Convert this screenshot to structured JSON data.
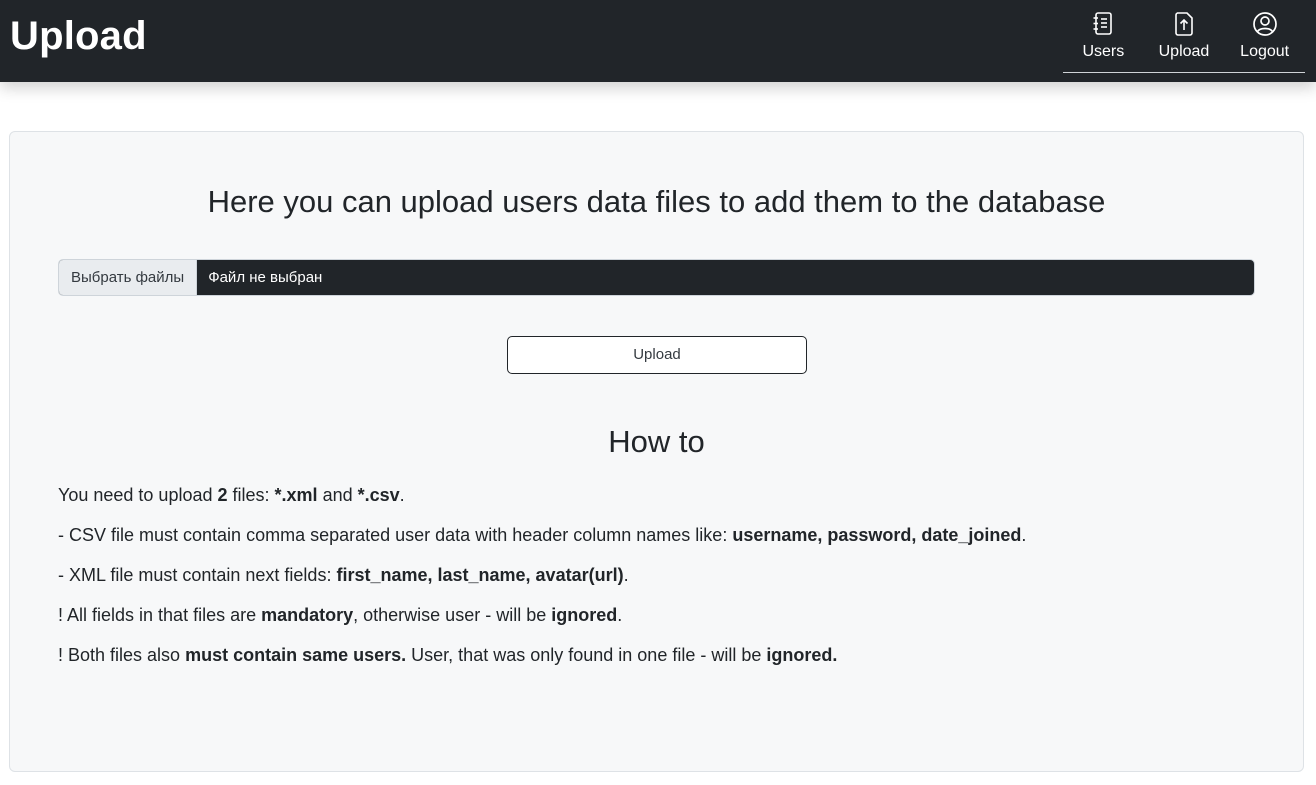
{
  "navbar": {
    "brand": "Upload",
    "items": [
      {
        "label": "Users",
        "icon": "journal-icon"
      },
      {
        "label": "Upload",
        "icon": "file-upload-icon"
      },
      {
        "label": "Logout",
        "icon": "person-circle-icon"
      }
    ]
  },
  "main": {
    "heading": "Here you can upload users data files to add them to the database",
    "file_input": {
      "button_label": "Выбрать файлы",
      "status": "Файл не выбран"
    },
    "upload_button": "Upload",
    "howto_title": "How to",
    "line1": {
      "t1": "You need to upload ",
      "b1": "2",
      "t2": " files: ",
      "b2": "*.xml",
      "t3": " and ",
      "b3": "*.csv",
      "t4": "."
    },
    "line2": {
      "t1": "- CSV file must contain comma separated user data with header column names like: ",
      "b1": "username, password, date_joined",
      "t2": "."
    },
    "line3": {
      "t1": "- XML file must contain next fields: ",
      "b1": "first_name, last_name, avatar(url)",
      "t2": "."
    },
    "line4": {
      "t1": "! All fields in that files are ",
      "b1": "mandatory",
      "t2": ", otherwise user - will be ",
      "b2": "ignored",
      "t3": "."
    },
    "line5": {
      "t1": "! Both files also ",
      "b1": "must contain same users.",
      "t2": " User, that was only found in one file - will be ",
      "b2": "ignored."
    }
  },
  "colors": {
    "navbar_bg": "#212529",
    "card_bg": "#f7f8f9",
    "text": "#212529"
  }
}
